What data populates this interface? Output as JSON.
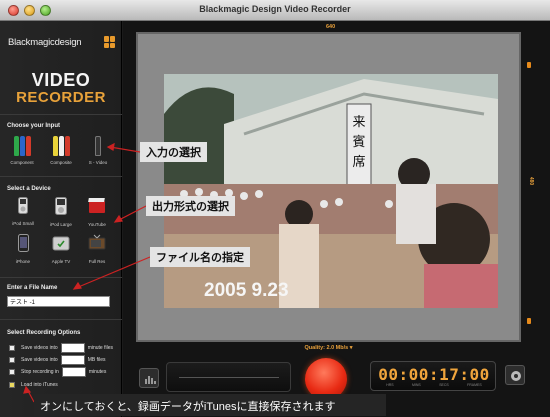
{
  "window": {
    "title": "Blackmagic Design Video Recorder"
  },
  "brand": {
    "company": "Blackmagicdesign",
    "product_line1": "VIDEO",
    "product_line2": "RECORDER"
  },
  "inputs": {
    "section_label": "Choose your Input",
    "items": [
      {
        "label": "Component",
        "plug_colors": [
          "#2ea84a",
          "#2a66c9",
          "#d33a2a"
        ]
      },
      {
        "label": "Composite",
        "plug_colors": [
          "#e9d33a",
          "#f0f0f0",
          "#d33a2a"
        ]
      },
      {
        "label": "S - Video",
        "plug_colors": [
          "#333333"
        ]
      }
    ]
  },
  "devices": {
    "section_label": "Select a Device",
    "items": [
      {
        "label": "iPod Small",
        "icon": "ipod-small-icon"
      },
      {
        "label": "iPod Large",
        "icon": "ipod-large-icon"
      },
      {
        "label": "YouTube",
        "icon": "youtube-icon"
      },
      {
        "label": "iPhone",
        "icon": "iphone-icon"
      },
      {
        "label": "Apple TV",
        "icon": "apple-tv-icon"
      },
      {
        "label": "Full Res",
        "icon": "tv-icon"
      }
    ]
  },
  "file_name": {
    "section_label": "Enter a File Name",
    "value": "テスト -1"
  },
  "recording_options": {
    "section_label": "Select Recording Options",
    "rows": [
      {
        "label": "Save videos into",
        "unit": "minute files",
        "checked": false
      },
      {
        "label": "Save videos into",
        "unit": "MB files",
        "checked": false
      },
      {
        "label": "Stop recording in",
        "unit": "minutes",
        "checked": false
      },
      {
        "label": "Load into iTunes",
        "unit": "",
        "checked": true
      }
    ]
  },
  "preview": {
    "width_label": "640",
    "height_label": "480",
    "video_timestamp": "2005  9.23",
    "quality": "Quality: 2.0 Mb/s ▾"
  },
  "timecode": {
    "value": "00:00:17:00",
    "units": [
      "HRS",
      "MINS",
      "SECS",
      "FRAMES"
    ]
  },
  "callouts": {
    "input": "入力の選択",
    "device": "出力形式の選択",
    "filename": "ファイル名の指定",
    "caption": "オンにしておくと、録画データがiTunesに直接保存されます"
  },
  "colors": {
    "accent": "#e9a13b",
    "record": "#e82a13"
  }
}
